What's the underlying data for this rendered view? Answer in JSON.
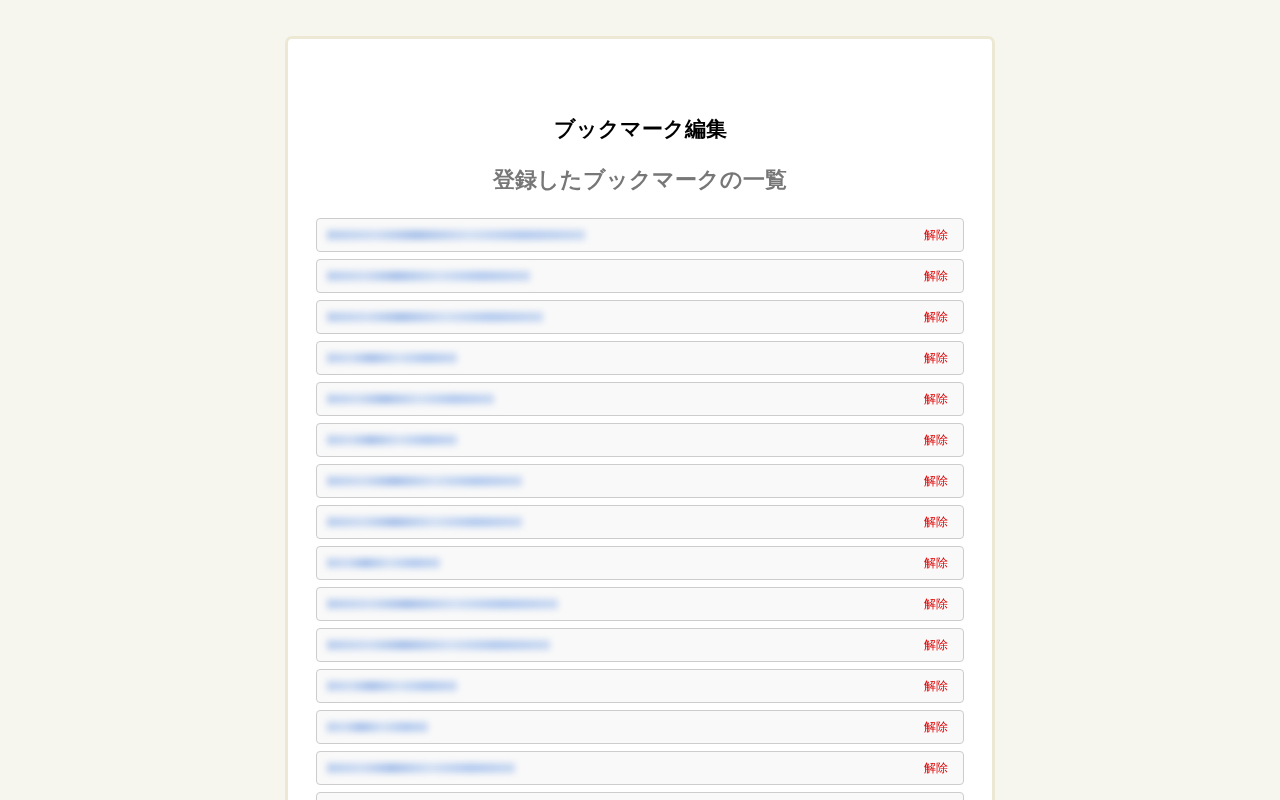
{
  "page": {
    "title": "ブックマーク編集",
    "subtitle": "登録したブックマークの一覧"
  },
  "rows": [
    {
      "redacted": true,
      "action": "解除"
    },
    {
      "redacted": true,
      "action": "解除"
    },
    {
      "redacted": true,
      "action": "解除"
    },
    {
      "redacted": true,
      "action": "解除"
    },
    {
      "redacted": true,
      "action": "解除"
    },
    {
      "redacted": true,
      "action": "解除"
    },
    {
      "redacted": true,
      "action": "解除"
    },
    {
      "redacted": true,
      "action": "解除"
    },
    {
      "redacted": true,
      "action": "解除"
    },
    {
      "redacted": true,
      "action": "解除"
    },
    {
      "redacted": true,
      "action": "解除"
    },
    {
      "redacted": true,
      "action": "解除"
    },
    {
      "redacted": true,
      "action": "解除"
    },
    {
      "redacted": true,
      "action": "解除"
    },
    {}
  ]
}
